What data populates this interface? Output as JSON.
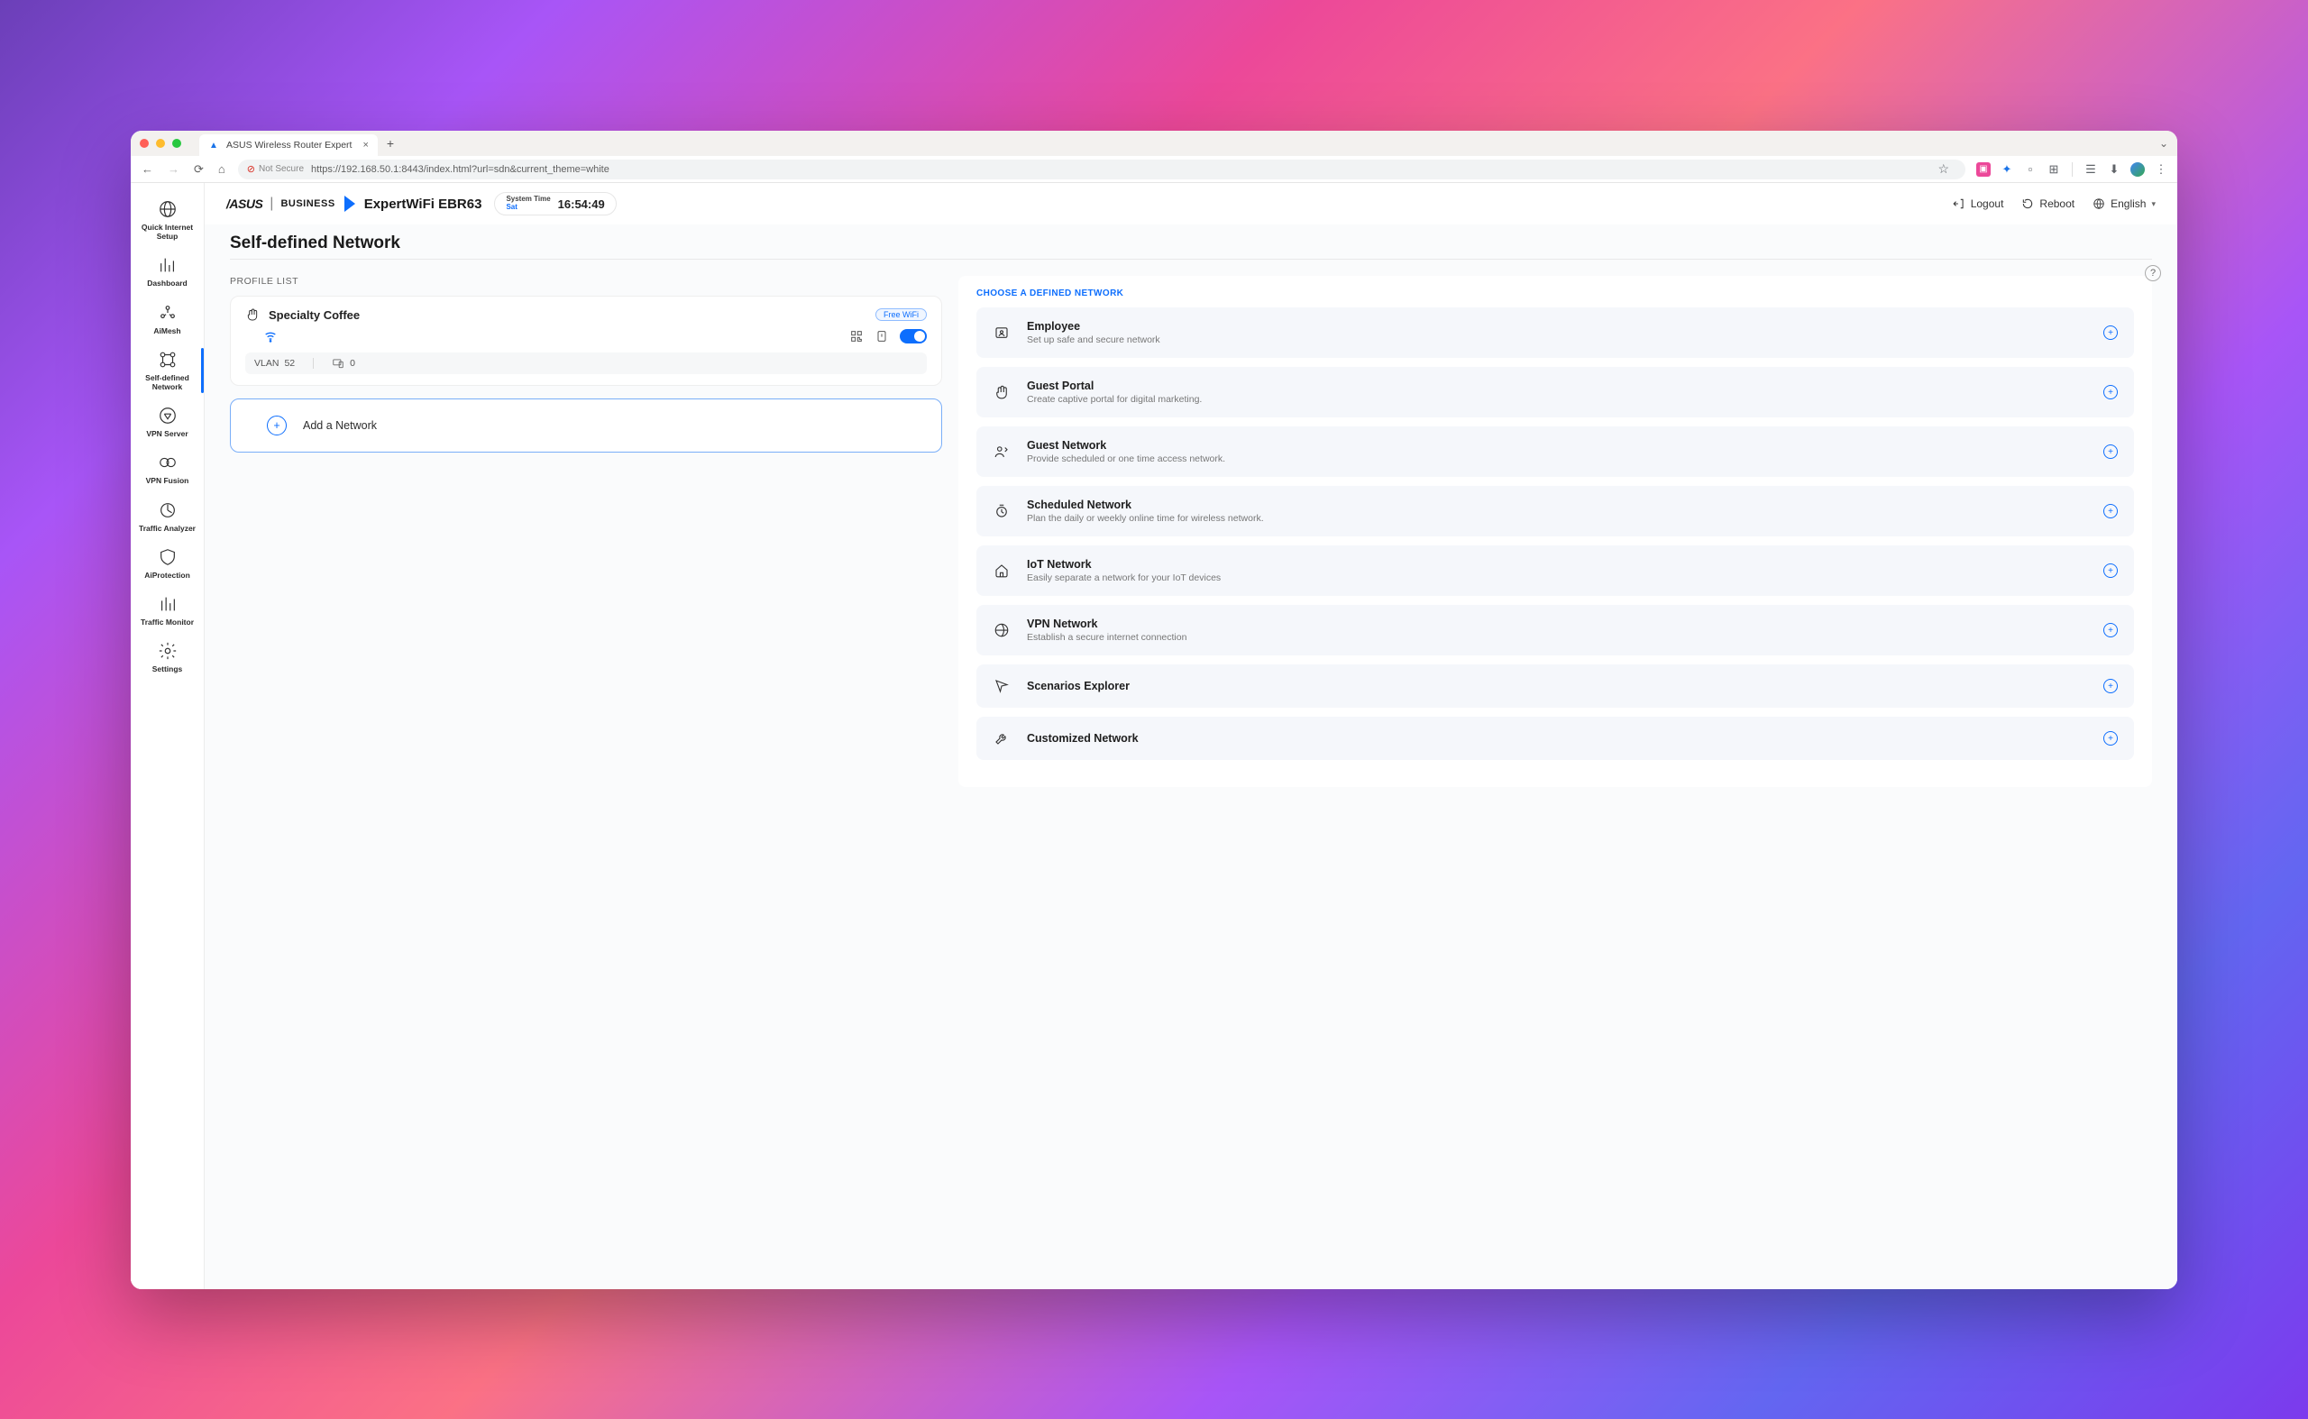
{
  "browser": {
    "tab_title": "ASUS Wireless Router Expert",
    "url": "https://192.168.50.1:8443/index.html?url=sdn&current_theme=white",
    "not_secure": "Not Secure"
  },
  "header": {
    "brand_main": "/ASUS",
    "brand_sub": "BUSINESS",
    "device": "ExpertWiFi EBR63",
    "systime_label": "System Time",
    "systime_day": "Sat",
    "systime_value": "16:54:49",
    "logout": "Logout",
    "reboot": "Reboot",
    "language": "English"
  },
  "sidebar": {
    "items": [
      {
        "label": "Quick Internet Setup"
      },
      {
        "label": "Dashboard"
      },
      {
        "label": "AiMesh"
      },
      {
        "label": "Self-defined Network"
      },
      {
        "label": "VPN Server"
      },
      {
        "label": "VPN Fusion"
      },
      {
        "label": "Traffic Analyzer"
      },
      {
        "label": "AiProtection"
      },
      {
        "label": "Traffic Monitor"
      },
      {
        "label": "Settings"
      }
    ]
  },
  "page": {
    "title": "Self-defined Network",
    "profile_list_label": "PROFILE LIST",
    "profile": {
      "name": "Specialty Coffee",
      "badge": "Free WiFi",
      "vlan_label": "VLAN",
      "vlan_id": "52",
      "device_count": "0"
    },
    "add_network": "Add a Network",
    "choose_label": "CHOOSE A DEFINED NETWORK",
    "options": [
      {
        "title": "Employee",
        "desc": "Set up safe and secure network"
      },
      {
        "title": "Guest Portal",
        "desc": "Create captive portal for digital marketing."
      },
      {
        "title": "Guest Network",
        "desc": "Provide scheduled or one time access network."
      },
      {
        "title": "Scheduled Network",
        "desc": "Plan the daily or weekly online time for wireless network."
      },
      {
        "title": "IoT Network",
        "desc": "Easily separate a network for your IoT devices"
      },
      {
        "title": "VPN Network",
        "desc": "Establish a secure internet connection"
      },
      {
        "title": "Scenarios Explorer",
        "desc": ""
      },
      {
        "title": "Customized Network",
        "desc": ""
      }
    ]
  }
}
